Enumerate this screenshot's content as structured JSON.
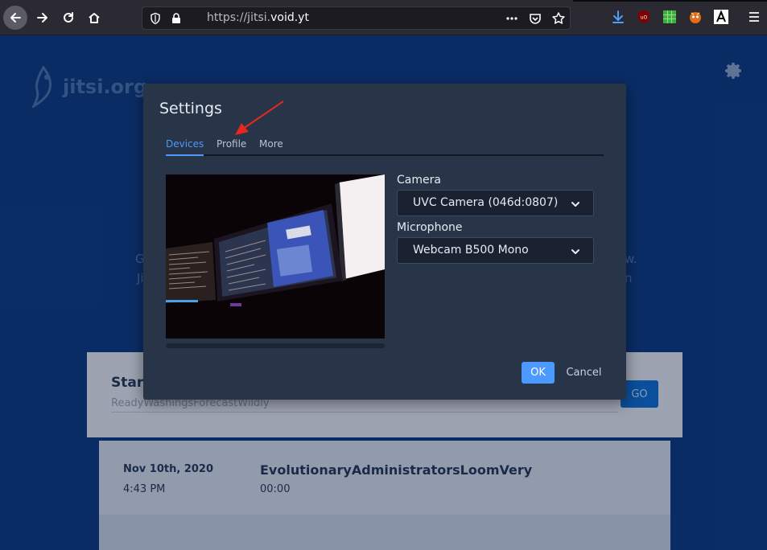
{
  "browser": {
    "url_prefix": "https://jitsi.",
    "url_domain": "void.yt"
  },
  "page": {
    "logo_text": "jitsi.org",
    "bg_text_left_1": "G",
    "bg_text_left_2": "Ji",
    "bg_text_right_1": "w.",
    "bg_text_right_2": "n",
    "start": {
      "title": "Star",
      "room_value": "ReadyWashingsForecastWildly",
      "go_label": "GO"
    },
    "recent": {
      "date": "Nov 10th, 2020",
      "time": "4:43 PM",
      "room_name": "EvolutionaryAdministratorsLoomVery",
      "duration": "00:00"
    }
  },
  "settings": {
    "title": "Settings",
    "tabs": [
      {
        "label": "Devices",
        "active": true
      },
      {
        "label": "Profile",
        "active": false
      },
      {
        "label": "More",
        "active": false
      }
    ],
    "camera": {
      "label": "Camera",
      "selected": "UVC Camera (046d:0807)"
    },
    "microphone": {
      "label": "Microphone",
      "selected": "Webcam B500 Mono"
    },
    "ok_label": "OK",
    "cancel_label": "Cancel"
  },
  "colors": {
    "accent": "#4c9aff",
    "modal_bg": "#283447",
    "page_bg": "#0d3a82",
    "annotation": "#e8281e"
  }
}
